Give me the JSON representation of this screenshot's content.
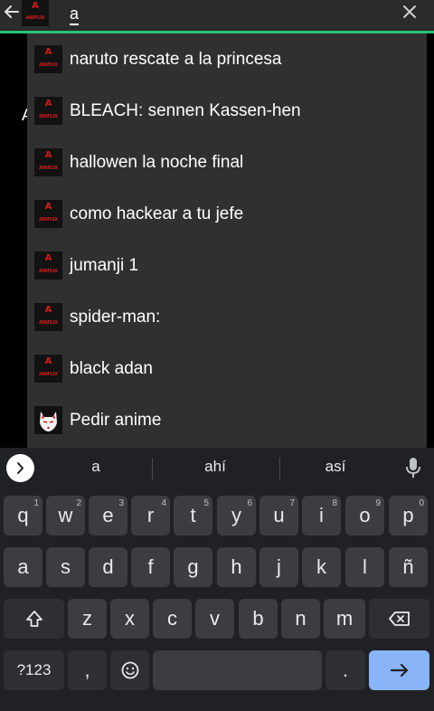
{
  "search": {
    "query": "a",
    "logo_letter": "A",
    "logo_word": "ANIFLIX"
  },
  "background": {
    "partial_letter": "A"
  },
  "suggestions": [
    {
      "text": "naruto rescate a la princesa",
      "icon": "aniflix-logo"
    },
    {
      "text": "BLEACH: sennen Kassen-hen",
      "icon": "aniflix-logo"
    },
    {
      "text": "hallowen la noche final",
      "icon": "aniflix-logo"
    },
    {
      "text": "como hackear a tu jefe",
      "icon": "aniflix-logo"
    },
    {
      "text": "jumanji 1",
      "icon": "aniflix-logo"
    },
    {
      "text": "spider-man:",
      "icon": "aniflix-logo"
    },
    {
      "text": "black adan",
      "icon": "aniflix-logo"
    },
    {
      "text": "Pedir anime",
      "icon": "kitsune-mask"
    }
  ],
  "keyboard": {
    "strip": [
      "a",
      "ahí",
      "así"
    ],
    "row1": [
      {
        "k": "q",
        "h": "1"
      },
      {
        "k": "w",
        "h": "2"
      },
      {
        "k": "e",
        "h": "3"
      },
      {
        "k": "r",
        "h": "4"
      },
      {
        "k": "t",
        "h": "5"
      },
      {
        "k": "y",
        "h": "6"
      },
      {
        "k": "u",
        "h": "7"
      },
      {
        "k": "i",
        "h": "8"
      },
      {
        "k": "o",
        "h": "9"
      },
      {
        "k": "p",
        "h": "0"
      }
    ],
    "row2": [
      "a",
      "s",
      "d",
      "f",
      "g",
      "h",
      "j",
      "k",
      "l",
      "ñ"
    ],
    "row3": [
      "z",
      "x",
      "c",
      "v",
      "b",
      "n",
      "m"
    ],
    "symbols_label": "?123",
    "comma": ",",
    "period": "."
  },
  "colors": {
    "accent_line": "#27c277",
    "logo_red": "#d31a1a",
    "enter_key": "#8ab4f8"
  }
}
